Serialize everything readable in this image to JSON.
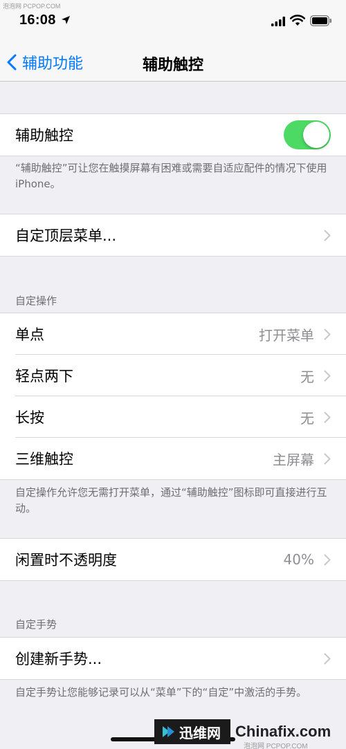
{
  "status_bar": {
    "time": "16:08",
    "watermark": "泡泡网 PCPOP.COM"
  },
  "nav": {
    "back_label": "辅助功能",
    "title": "辅助触控"
  },
  "toggle_row": {
    "label": "辅助触控",
    "on": true,
    "footnote": "“辅助触控”可让您在触摸屏幕有困难或需要自适应配件的情况下使用 iPhone。"
  },
  "top_menu_row": {
    "label": "自定顶层菜单..."
  },
  "custom_actions": {
    "header": "自定操作",
    "rows": [
      {
        "label": "单点",
        "value": "打开菜单"
      },
      {
        "label": "轻点两下",
        "value": "无"
      },
      {
        "label": "长按",
        "value": "无"
      },
      {
        "label": "三维触控",
        "value": "主屏幕"
      }
    ],
    "footnote": "自定操作允许您无需打开菜单，通过“辅助触控”图标即可直接进行互动。"
  },
  "opacity_row": {
    "label": "闲置时不透明度",
    "value": "40%"
  },
  "custom_gestures": {
    "header": "自定手势",
    "row_label": "创建新手势...",
    "footnote": "自定手势让您能够记录可以从“菜单”下的“自定”中激活的手势。"
  },
  "watermarks": {
    "xunwei": "迅维网",
    "chinafix": "Chinafix.com",
    "pcpop": "泡泡网 PCPOP.COM"
  },
  "colors": {
    "accent": "#007aff",
    "toggle_on": "#4cd964",
    "background": "#efeff4"
  }
}
